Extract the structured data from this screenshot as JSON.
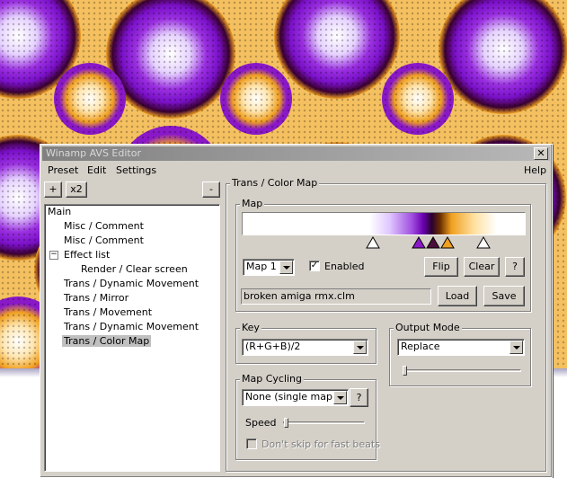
{
  "window": {
    "title": "Winamp AVS Editor",
    "close_glyph": "✕"
  },
  "menu": {
    "preset": "Preset",
    "edit": "Edit",
    "settings": "Settings",
    "help": "Help"
  },
  "toolbar": {
    "add": "+",
    "x2": "x2",
    "remove": "-"
  },
  "tree": {
    "items": [
      "Main",
      "Misc / Comment",
      "Misc / Comment",
      "Effect list",
      "Render / Clear screen",
      "Trans / Dynamic Movement",
      "Trans / Mirror",
      "Trans / Movement",
      "Trans / Dynamic Movement",
      "Trans / Color Map"
    ],
    "expand_glyph": "−",
    "selected": "Trans / Color Map"
  },
  "panel": {
    "title": "Trans / Color Map",
    "map": {
      "label": "Map",
      "select_value": "Map 1",
      "enabled_label": "Enabled",
      "enabled_checked": true,
      "check_glyph": "✓",
      "flip": "Flip",
      "clear": "Clear",
      "help": "?",
      "filename": "broken amiga rmx.clm",
      "load": "Load",
      "save": "Save",
      "markers": [
        {
          "color": "#ffffff"
        },
        {
          "color": "#8a18c8"
        },
        {
          "color": "#4a0e3a"
        },
        {
          "color": "#f0a020"
        },
        {
          "color": "#ffffff"
        }
      ]
    },
    "key": {
      "label": "Key",
      "value": "(R+G+B)/2"
    },
    "output_mode": {
      "label": "Output Mode",
      "value": "Replace",
      "slider_fraction": 0.0
    },
    "cycling": {
      "label": "Map Cycling",
      "value": "None (single map)",
      "help": "?",
      "speed_label": "Speed",
      "speed_fraction": 0.0,
      "skip_label": "Don't skip for fast beats",
      "skip_checked": false
    }
  },
  "colors": {
    "accent_purple": "#8a18c8",
    "accent_orange": "#f0a020",
    "dialog_gray": "#d4d0c8"
  }
}
